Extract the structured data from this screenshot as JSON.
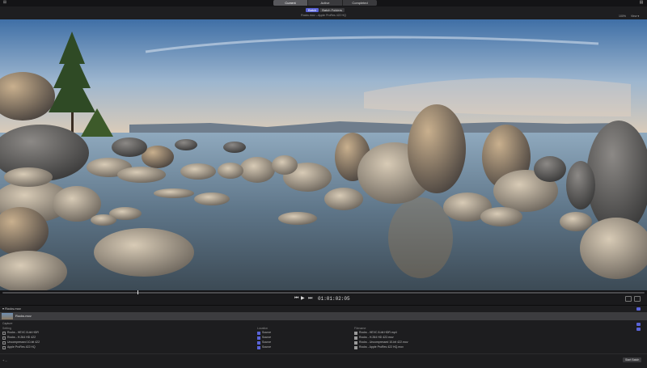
{
  "top_tabs": [
    "Current",
    "Active",
    "Completed"
  ],
  "window_button_left": "⊞",
  "window_button_right": "▤",
  "mode_tabs": [
    "Batch",
    "Batch Folders"
  ],
  "preset_label": "Rocks.mov – Apple ProRes 422 HQ",
  "view_controls": {
    "zoom": "100%",
    "view": "View ▾"
  },
  "timecode": "01:01:02:05",
  "transport_icons": [
    "skip-back-icon",
    "play-icon",
    "skip-forward-icon"
  ],
  "scrub_progress": 0.21,
  "panel": {
    "title": "▾ Rocks.mov",
    "file_name": "Rocks.mov",
    "section_label": "Capture",
    "column_headers": [
      "Setting",
      "Location",
      "Filename"
    ],
    "rows": [
      {
        "setting": "Rocks - HEVC 8-bit HDR",
        "location": "Source",
        "filename": "Rocks - HEVC 8-bit HDR.mp4"
      },
      {
        "setting": "Rocks - H.264 HD 422",
        "location": "Source",
        "filename": "Rocks - H.264 HD 422.mov"
      },
      {
        "setting": "Uncompressed 10-bit 422",
        "location": "Source",
        "filename": "Rocks - Uncompressed 10-bit 422.mov"
      },
      {
        "setting": "Apple ProRes 422 HQ",
        "location": "Source",
        "filename": "Rocks - Apple ProRes 422 HQ.mov"
      }
    ]
  },
  "footer": {
    "plus_minus": "+ –",
    "start_button": "Start Batch"
  },
  "colors": {
    "accent": "#5a64d8",
    "bg": "#1b1b1d"
  }
}
